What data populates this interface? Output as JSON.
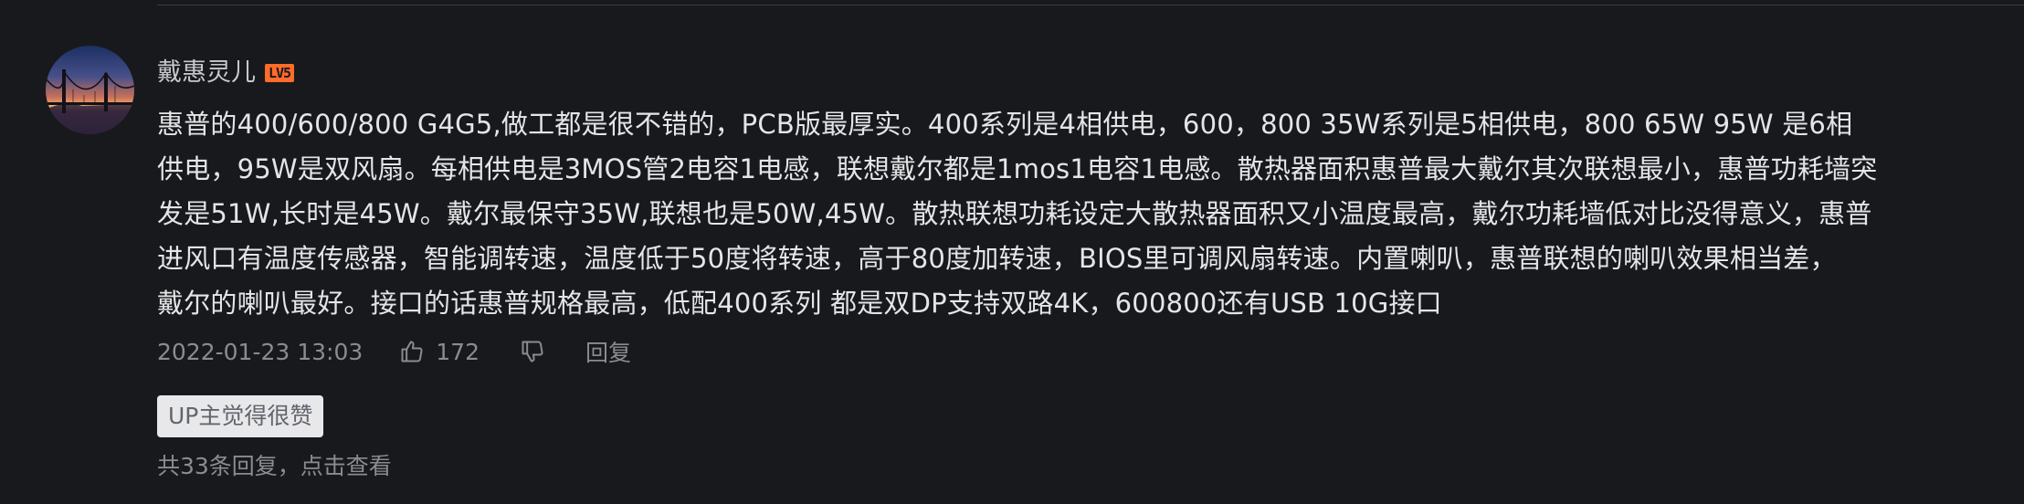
{
  "comment": {
    "username": "戴惠灵儿",
    "level_badge": "LV5",
    "text_lines": [
      "惠普的400/600/800 G4G5,做工都是很不错的，PCB版最厚实。400系列是4相供电，600，800 35W系列是5相供电，800 65W 95W 是6相",
      "供电，95W是双风扇。每相供电是3MOS管2电容1电感，联想戴尔都是1mos1电容1电感。散热器面积惠普最大戴尔其次联想最小，惠普功耗墙突",
      "发是51W,长时是45W。戴尔最保守35W,联想也是50W,45W。散热联想功耗设定大散热器面积又小温度最高，戴尔功耗墙低对比没得意义，惠普",
      "进风口有温度传感器，智能调转速，温度低于50度将转速，高于80度加转速，BIOS里可调风扇转速。内置喇叭，惠普联想的喇叭效果相当差，",
      "戴尔的喇叭最好。接口的话惠普规格最高，低配400系列 都是双DP支持双路4K，600800还有USB 10G接口"
    ],
    "timestamp": "2022-01-23 13:03",
    "like_count": "172",
    "reply_label": "回复",
    "up_tag": "UP主觉得很赞",
    "replies_summary": "共33条回复，点击查看"
  },
  "icons": {
    "like": "thumbs-up-icon",
    "dislike": "thumbs-down-icon",
    "avatar": "golden-gate-bridge-sunset"
  },
  "colors": {
    "background": "#18191c",
    "text": "#e3e5e7",
    "muted": "#8a8c91",
    "badge": "#ff6b2b"
  }
}
